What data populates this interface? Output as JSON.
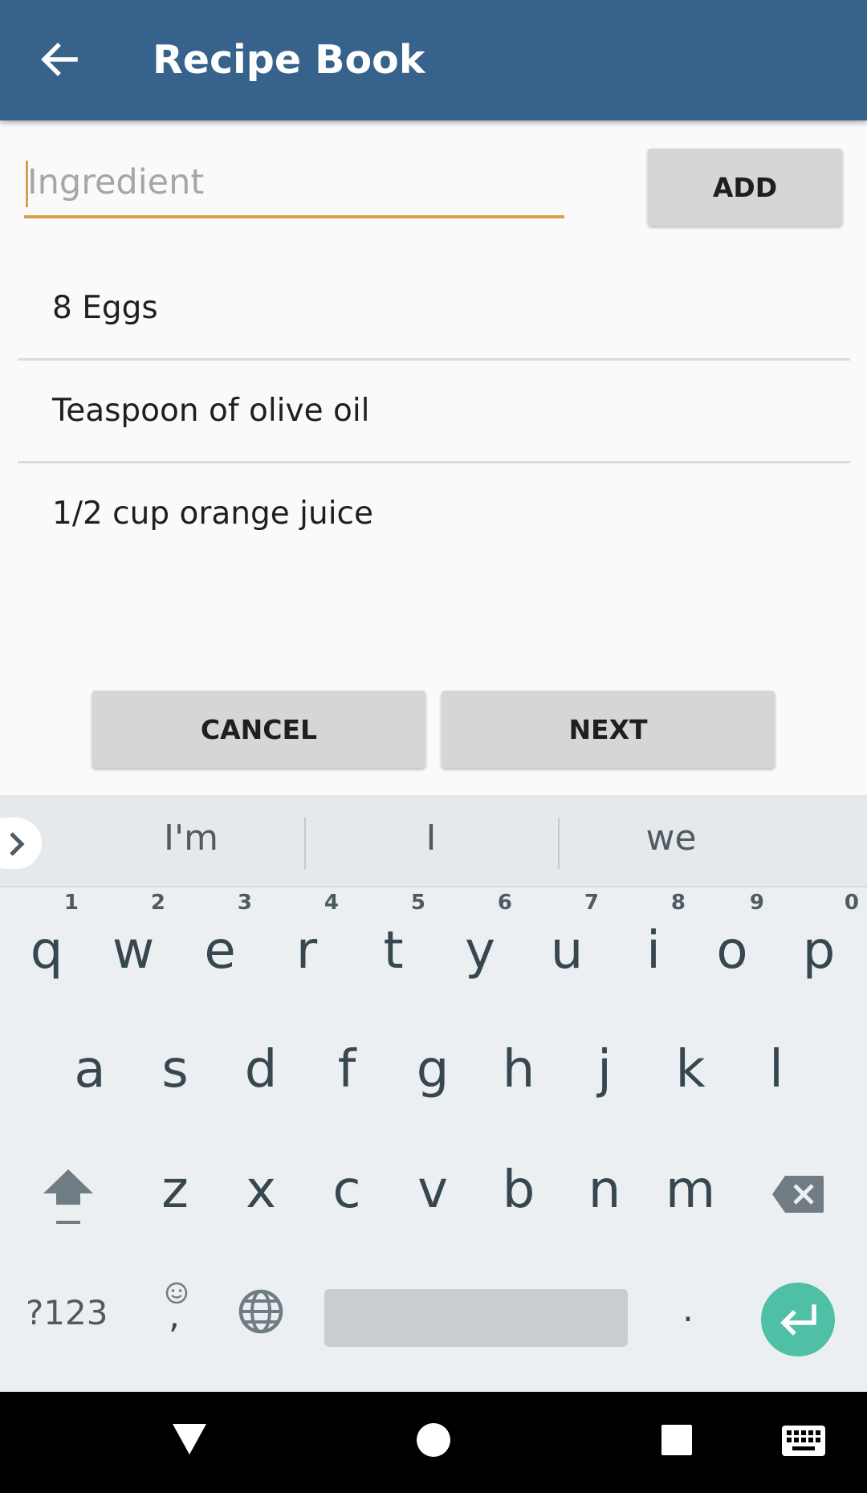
{
  "app_bar": {
    "title": "Recipe Book",
    "back_icon": "arrow-back-icon"
  },
  "ingredient_input": {
    "value": "",
    "placeholder": "Ingredient"
  },
  "add_button": "ADD",
  "ingredients": [
    "8 Eggs",
    "Teaspoon of olive oil",
    "1/2 cup orange juice"
  ],
  "actions": {
    "cancel": "CANCEL",
    "next": "NEXT"
  },
  "keyboard": {
    "suggestions": [
      "I'm",
      "I",
      "we"
    ],
    "row1": [
      {
        "key": "q",
        "num": "1"
      },
      {
        "key": "w",
        "num": "2"
      },
      {
        "key": "e",
        "num": "3"
      },
      {
        "key": "r",
        "num": "4"
      },
      {
        "key": "t",
        "num": "5"
      },
      {
        "key": "y",
        "num": "6"
      },
      {
        "key": "u",
        "num": "7"
      },
      {
        "key": "i",
        "num": "8"
      },
      {
        "key": "o",
        "num": "9"
      },
      {
        "key": "p",
        "num": "0"
      }
    ],
    "row2": [
      "a",
      "s",
      "d",
      "f",
      "g",
      "h",
      "j",
      "k",
      "l"
    ],
    "row3": [
      "z",
      "x",
      "c",
      "v",
      "b",
      "n",
      "m"
    ],
    "symbols_label": "?123",
    "comma_label": ",",
    "period_label": "."
  },
  "colors": {
    "app_bar": "#36628b",
    "accent": "#d9a04c",
    "enter_key": "#4fbfa5"
  }
}
